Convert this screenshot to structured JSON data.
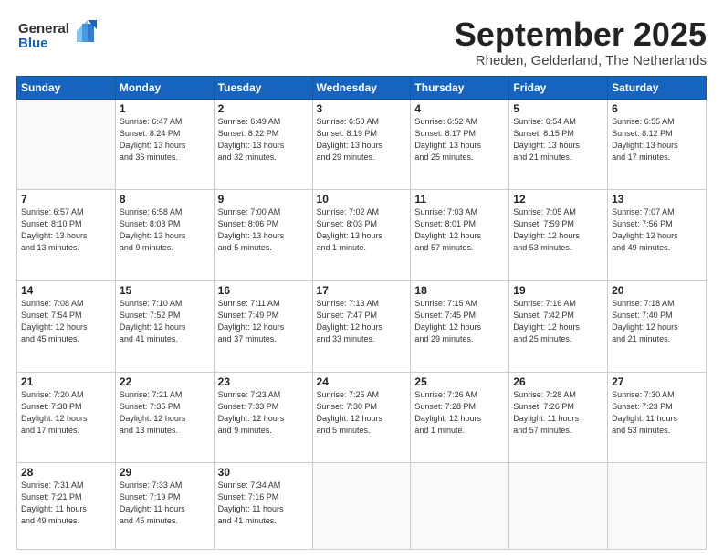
{
  "header": {
    "logo_line1": "General",
    "logo_line2": "Blue",
    "month": "September 2025",
    "location": "Rheden, Gelderland, The Netherlands"
  },
  "weekdays": [
    "Sunday",
    "Monday",
    "Tuesday",
    "Wednesday",
    "Thursday",
    "Friday",
    "Saturday"
  ],
  "weeks": [
    [
      {
        "day": "",
        "info": ""
      },
      {
        "day": "1",
        "info": "Sunrise: 6:47 AM\nSunset: 8:24 PM\nDaylight: 13 hours\nand 36 minutes."
      },
      {
        "day": "2",
        "info": "Sunrise: 6:49 AM\nSunset: 8:22 PM\nDaylight: 13 hours\nand 32 minutes."
      },
      {
        "day": "3",
        "info": "Sunrise: 6:50 AM\nSunset: 8:19 PM\nDaylight: 13 hours\nand 29 minutes."
      },
      {
        "day": "4",
        "info": "Sunrise: 6:52 AM\nSunset: 8:17 PM\nDaylight: 13 hours\nand 25 minutes."
      },
      {
        "day": "5",
        "info": "Sunrise: 6:54 AM\nSunset: 8:15 PM\nDaylight: 13 hours\nand 21 minutes."
      },
      {
        "day": "6",
        "info": "Sunrise: 6:55 AM\nSunset: 8:12 PM\nDaylight: 13 hours\nand 17 minutes."
      }
    ],
    [
      {
        "day": "7",
        "info": "Sunrise: 6:57 AM\nSunset: 8:10 PM\nDaylight: 13 hours\nand 13 minutes."
      },
      {
        "day": "8",
        "info": "Sunrise: 6:58 AM\nSunset: 8:08 PM\nDaylight: 13 hours\nand 9 minutes."
      },
      {
        "day": "9",
        "info": "Sunrise: 7:00 AM\nSunset: 8:06 PM\nDaylight: 13 hours\nand 5 minutes."
      },
      {
        "day": "10",
        "info": "Sunrise: 7:02 AM\nSunset: 8:03 PM\nDaylight: 13 hours\nand 1 minute."
      },
      {
        "day": "11",
        "info": "Sunrise: 7:03 AM\nSunset: 8:01 PM\nDaylight: 12 hours\nand 57 minutes."
      },
      {
        "day": "12",
        "info": "Sunrise: 7:05 AM\nSunset: 7:59 PM\nDaylight: 12 hours\nand 53 minutes."
      },
      {
        "day": "13",
        "info": "Sunrise: 7:07 AM\nSunset: 7:56 PM\nDaylight: 12 hours\nand 49 minutes."
      }
    ],
    [
      {
        "day": "14",
        "info": "Sunrise: 7:08 AM\nSunset: 7:54 PM\nDaylight: 12 hours\nand 45 minutes."
      },
      {
        "day": "15",
        "info": "Sunrise: 7:10 AM\nSunset: 7:52 PM\nDaylight: 12 hours\nand 41 minutes."
      },
      {
        "day": "16",
        "info": "Sunrise: 7:11 AM\nSunset: 7:49 PM\nDaylight: 12 hours\nand 37 minutes."
      },
      {
        "day": "17",
        "info": "Sunrise: 7:13 AM\nSunset: 7:47 PM\nDaylight: 12 hours\nand 33 minutes."
      },
      {
        "day": "18",
        "info": "Sunrise: 7:15 AM\nSunset: 7:45 PM\nDaylight: 12 hours\nand 29 minutes."
      },
      {
        "day": "19",
        "info": "Sunrise: 7:16 AM\nSunset: 7:42 PM\nDaylight: 12 hours\nand 25 minutes."
      },
      {
        "day": "20",
        "info": "Sunrise: 7:18 AM\nSunset: 7:40 PM\nDaylight: 12 hours\nand 21 minutes."
      }
    ],
    [
      {
        "day": "21",
        "info": "Sunrise: 7:20 AM\nSunset: 7:38 PM\nDaylight: 12 hours\nand 17 minutes."
      },
      {
        "day": "22",
        "info": "Sunrise: 7:21 AM\nSunset: 7:35 PM\nDaylight: 12 hours\nand 13 minutes."
      },
      {
        "day": "23",
        "info": "Sunrise: 7:23 AM\nSunset: 7:33 PM\nDaylight: 12 hours\nand 9 minutes."
      },
      {
        "day": "24",
        "info": "Sunrise: 7:25 AM\nSunset: 7:30 PM\nDaylight: 12 hours\nand 5 minutes."
      },
      {
        "day": "25",
        "info": "Sunrise: 7:26 AM\nSunset: 7:28 PM\nDaylight: 12 hours\nand 1 minute."
      },
      {
        "day": "26",
        "info": "Sunrise: 7:28 AM\nSunset: 7:26 PM\nDaylight: 11 hours\nand 57 minutes."
      },
      {
        "day": "27",
        "info": "Sunrise: 7:30 AM\nSunset: 7:23 PM\nDaylight: 11 hours\nand 53 minutes."
      }
    ],
    [
      {
        "day": "28",
        "info": "Sunrise: 7:31 AM\nSunset: 7:21 PM\nDaylight: 11 hours\nand 49 minutes."
      },
      {
        "day": "29",
        "info": "Sunrise: 7:33 AM\nSunset: 7:19 PM\nDaylight: 11 hours\nand 45 minutes."
      },
      {
        "day": "30",
        "info": "Sunrise: 7:34 AM\nSunset: 7:16 PM\nDaylight: 11 hours\nand 41 minutes."
      },
      {
        "day": "",
        "info": ""
      },
      {
        "day": "",
        "info": ""
      },
      {
        "day": "",
        "info": ""
      },
      {
        "day": "",
        "info": ""
      }
    ]
  ]
}
